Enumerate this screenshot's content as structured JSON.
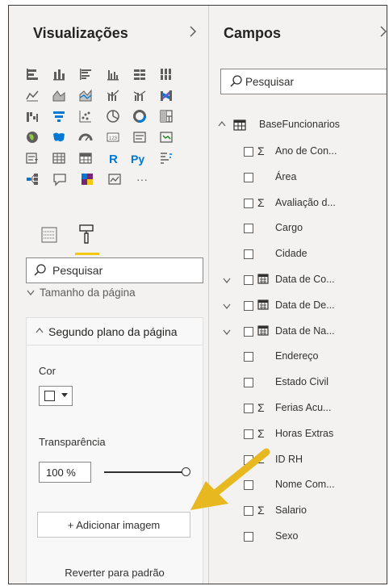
{
  "visualizations": {
    "title": "Visualizações",
    "collapse_icon": "chevron-right-icon",
    "more_label": "···",
    "search_placeholder": "Pesquisar",
    "section_collapsed_label": "Tamanho da página",
    "section_expanded_label": "Segundo plano da página",
    "color_label": "Cor",
    "color_value": "#ffffff",
    "transparency_label": "Transparência",
    "transparency_value": "100 %",
    "transparency_level_percent": 100,
    "add_image_label": "+ Adicionar imagem",
    "revert_label": "Reverter para padrão",
    "active_tab": "format-paint-icon",
    "accent_color": "#f2c811"
  },
  "fields": {
    "title": "Campos",
    "collapse_icon": "chevron-right-icon",
    "search_placeholder": "Pesquisar",
    "table_name": "BaseFuncionarios",
    "items": [
      {
        "name": "Ano de Con...",
        "type": "sigma",
        "expandable": false
      },
      {
        "name": "Área",
        "type": "text",
        "expandable": false
      },
      {
        "name": "Avaliação d...",
        "type": "sigma",
        "expandable": false
      },
      {
        "name": "Cargo",
        "type": "text",
        "expandable": false
      },
      {
        "name": "Cidade",
        "type": "text",
        "expandable": false
      },
      {
        "name": "Data de Co...",
        "type": "calendar",
        "expandable": true
      },
      {
        "name": "Data de De...",
        "type": "calendar",
        "expandable": true
      },
      {
        "name": "Data de Na...",
        "type": "calendar",
        "expandable": true
      },
      {
        "name": "Endereço",
        "type": "text",
        "expandable": false
      },
      {
        "name": "Estado Civil",
        "type": "text",
        "expandable": false
      },
      {
        "name": "Ferias Acu...",
        "type": "sigma",
        "expandable": false
      },
      {
        "name": "Horas Extras",
        "type": "sigma",
        "expandable": false
      },
      {
        "name": "ID RH",
        "type": "sigma",
        "expandable": false
      },
      {
        "name": "Nome Com...",
        "type": "text",
        "expandable": false
      },
      {
        "name": "Salario",
        "type": "sigma",
        "expandable": false
      },
      {
        "name": "Sexo",
        "type": "text",
        "expandable": false
      }
    ]
  },
  "annotation": {
    "arrow_color": "#e8b820"
  }
}
